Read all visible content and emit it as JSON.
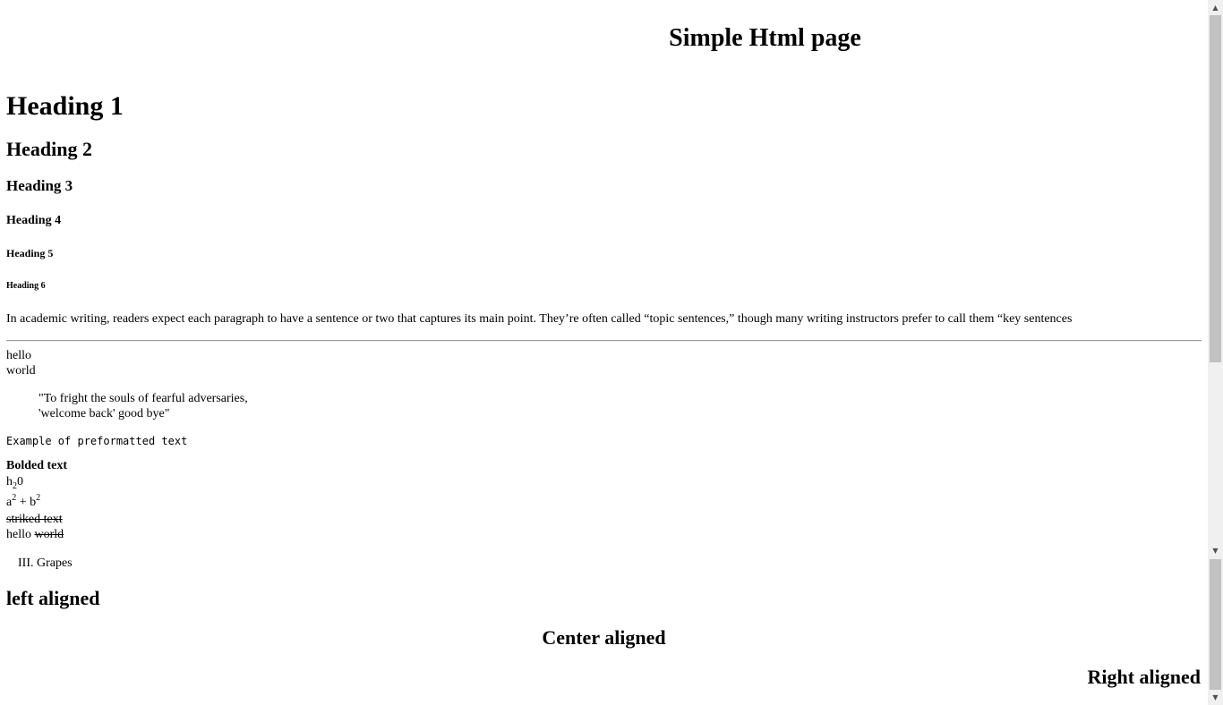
{
  "page": {
    "title": "Simple Html page"
  },
  "headings": {
    "h1": "Heading 1",
    "h2": "Heading 2",
    "h3": "Heading 3",
    "h4": "Heading 4",
    "h5": "Heading 5",
    "h6": "Heading 6"
  },
  "paragraph": "In academic writing, readers expect each paragraph to have a sentence or two that captures its main point. They’re often called “topic sentences,” though many writing instructors prefer to call them “key sentences",
  "lines": {
    "hello": "hello",
    "world": "world"
  },
  "blockquote": {
    "line1": "\"To fright the souls of fearful adversaries,",
    "line2": "'welcome back' good bye\""
  },
  "preformatted": "Example of preformatted text",
  "formatting": {
    "bold": "Bolded text",
    "sub_base": "h",
    "sub_value": "2",
    "sub_tail": "0",
    "sup_a": "a",
    "sup_a_exp": "2",
    "sup_plus": " + b",
    "sup_b_exp": "2",
    "striked": "striked text",
    "mixed_plain": "hello ",
    "mixed_striked": "world"
  },
  "list": {
    "item": "III. Grapes"
  },
  "alignment": {
    "left": "left aligned",
    "center": "Center aligned",
    "right": "Right aligned"
  },
  "scrollbar": {
    "up_icon": "▲",
    "down_icon": "▼",
    "mid_icon": "▼"
  }
}
